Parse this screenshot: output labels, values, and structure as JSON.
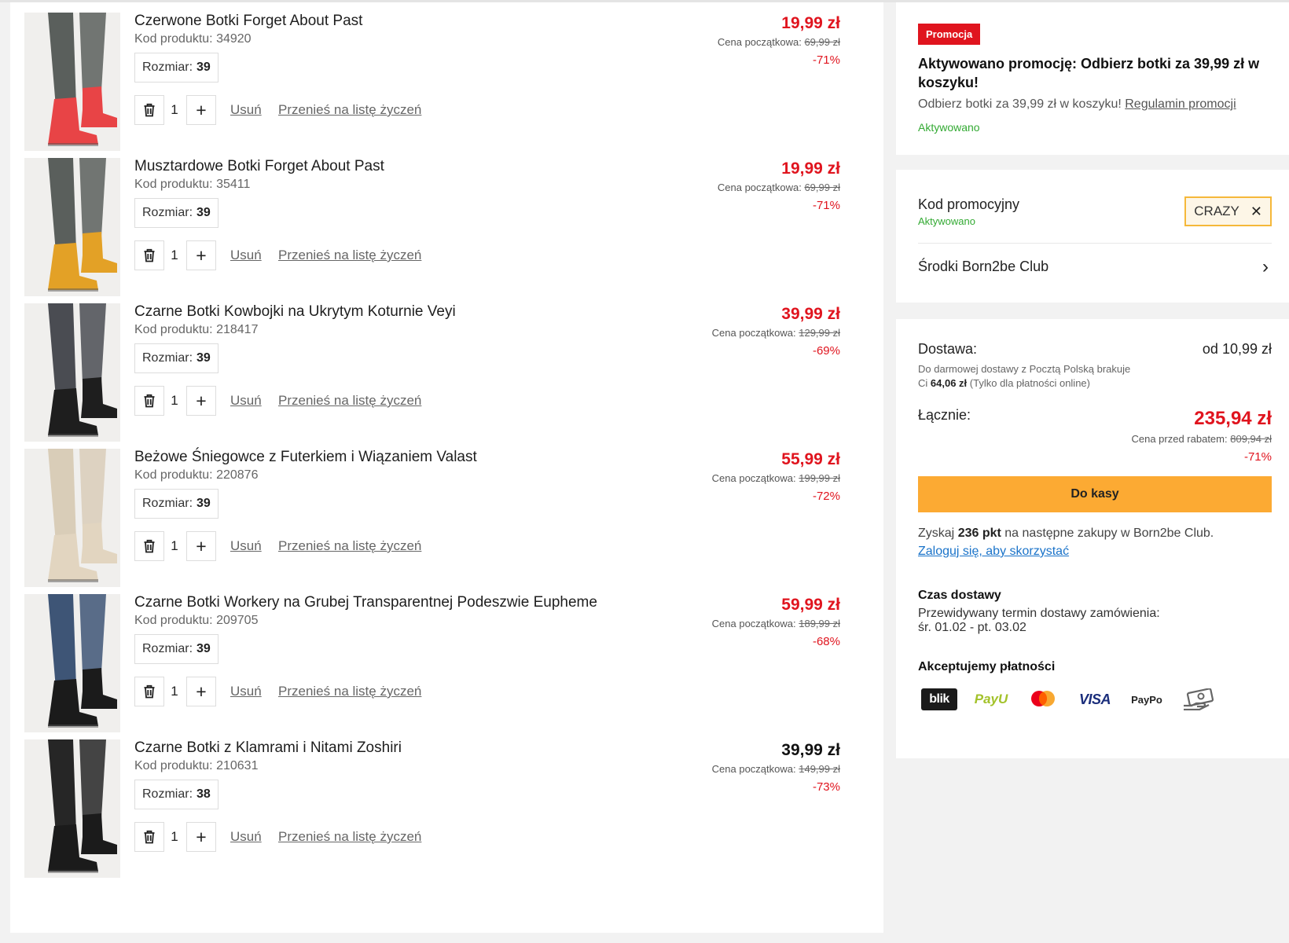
{
  "cart": {
    "size_label": "Rozmiar:",
    "remove_label": "Usuń",
    "wishlist_label": "Przenieś na listę życzeń",
    "orig_label": "Cena początkowa:",
    "items": [
      {
        "name": "Czerwone Botki Forget About Past",
        "code": "Kod produktu: 34920",
        "size": "39",
        "qty": "1",
        "price": "19,99 zł",
        "orig_price": "69,99 zł",
        "discount": "-71%",
        "boot_color": "#e84446",
        "leg_color": "#5a5f5c"
      },
      {
        "name": "Musztardowe Botki Forget About Past",
        "code": "Kod produktu: 35411",
        "size": "39",
        "qty": "1",
        "price": "19,99 zł",
        "orig_price": "69,99 zł",
        "discount": "-71%",
        "boot_color": "#e3a126",
        "leg_color": "#5a5f5c"
      },
      {
        "name": "Czarne Botki Kowbojki na Ukrytym Koturnie Veyi",
        "code": "Kod produktu: 218417",
        "size": "39",
        "qty": "1",
        "price": "39,99 zł",
        "orig_price": "129,99 zł",
        "discount": "-69%",
        "boot_color": "#1e1e1e",
        "leg_color": "#4a4c52"
      },
      {
        "name": "Beżowe Śniegowce z Futerkiem i Wiązaniem Valast",
        "code": "Kod produktu: 220876",
        "size": "39",
        "qty": "1",
        "price": "55,99 zł",
        "orig_price": "199,99 zł",
        "discount": "-72%",
        "boot_color": "#e2d5c0",
        "leg_color": "#d9cdb8"
      },
      {
        "name": "Czarne Botki Workery na Grubej Transparentnej Podeszwie Eupheme",
        "code": "Kod produktu: 209705",
        "size": "39",
        "qty": "1",
        "price": "59,99 zł",
        "orig_price": "189,99 zł",
        "discount": "-68%",
        "boot_color": "#1b1b1b",
        "leg_color": "#3e5576"
      },
      {
        "name": "Czarne Botki z Klamrami i Nitami Zoshiri",
        "code": "Kod produktu: 210631",
        "size": "38",
        "qty": "1",
        "price": "39,99 zł",
        "orig_price": "149,99 zł",
        "discount": "-73%",
        "boot_color": "#1b1b1b",
        "leg_color": "#262626"
      }
    ]
  },
  "promo": {
    "badge": "Promocja",
    "title": "Aktywowano promocję: Odbierz botki za 39,99 zł w koszyku!",
    "desc": "Odbierz botki za 39,99 zł w koszyku!",
    "rules_link": "Regulamin promocji",
    "status": "Aktywowano"
  },
  "code_panel": {
    "label": "Kod promocyjny",
    "status": "Aktywowano",
    "code": "CRAZY",
    "club_label": "Środki Born2be Club"
  },
  "summary": {
    "delivery_label": "Dostawa:",
    "delivery_value": "od 10,99 zł",
    "free_note1": "Do darmowej dostawy z Pocztą Polską brakuje",
    "free_note_prefix": "Ci",
    "free_note_amount": "64,06 zł",
    "free_note_suffix": "(Tylko dla płatności online)",
    "total_label": "Łącznie:",
    "total_value": "235,94 zł",
    "before_discount_label": "Cena przed rabatem:",
    "before_discount_value": "809,94 zł",
    "total_discount": "-71%",
    "checkout_label": "Do kasy",
    "points_prefix": "Zyskaj",
    "points_value": "236 pkt",
    "points_suffix": "na następne zakupy w Born2be Club.",
    "login_link": "Zaloguj się, aby skorzystać",
    "delivery_time_title": "Czas dostawy",
    "delivery_time_line1": "Przewidywany termin dostawy zamówienia:",
    "delivery_time_line2": "śr. 01.02 - pt. 03.02",
    "payments_title": "Akceptujemy płatności",
    "payments": {
      "blik": "blik",
      "payu": "PayU",
      "visa": "VISA",
      "paypo": "PayPo"
    }
  }
}
